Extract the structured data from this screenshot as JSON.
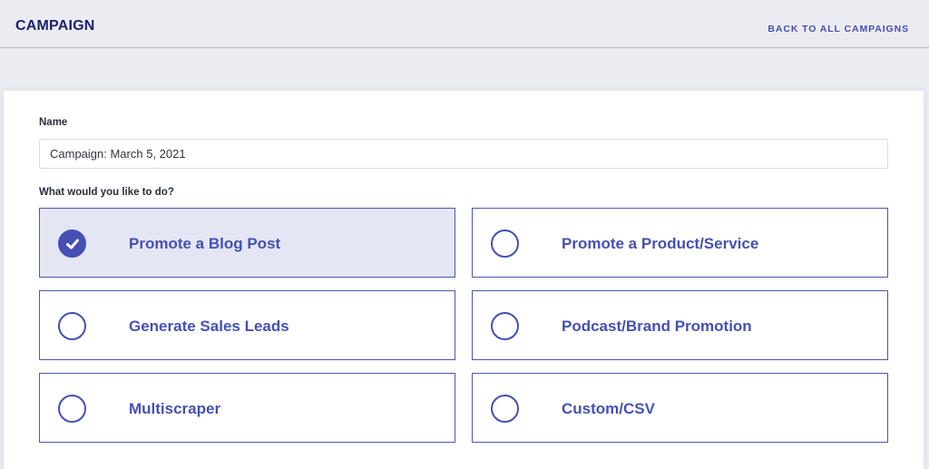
{
  "header": {
    "title": "CAMPAIGN",
    "back_link": "BACK TO ALL CAMPAIGNS"
  },
  "form": {
    "name_label": "Name",
    "name_value": "Campaign: March 5, 2021",
    "question_label": "What would you like to do?",
    "options": [
      {
        "label": "Promote a Blog Post",
        "selected": true
      },
      {
        "label": "Promote a Product/Service",
        "selected": false
      },
      {
        "label": "Generate Sales Leads",
        "selected": false
      },
      {
        "label": "Podcast/Brand Promotion",
        "selected": false
      },
      {
        "label": "Multiscraper",
        "selected": false
      },
      {
        "label": "Custom/CSV",
        "selected": false
      }
    ]
  },
  "colors": {
    "accent": "#4550b4",
    "title": "#1b2170",
    "selected_bg": "#e4e6f4",
    "page_bg": "#ebecf2"
  },
  "icons": {
    "selected": "check-circle-icon",
    "unselected": "radio-empty-icon"
  }
}
